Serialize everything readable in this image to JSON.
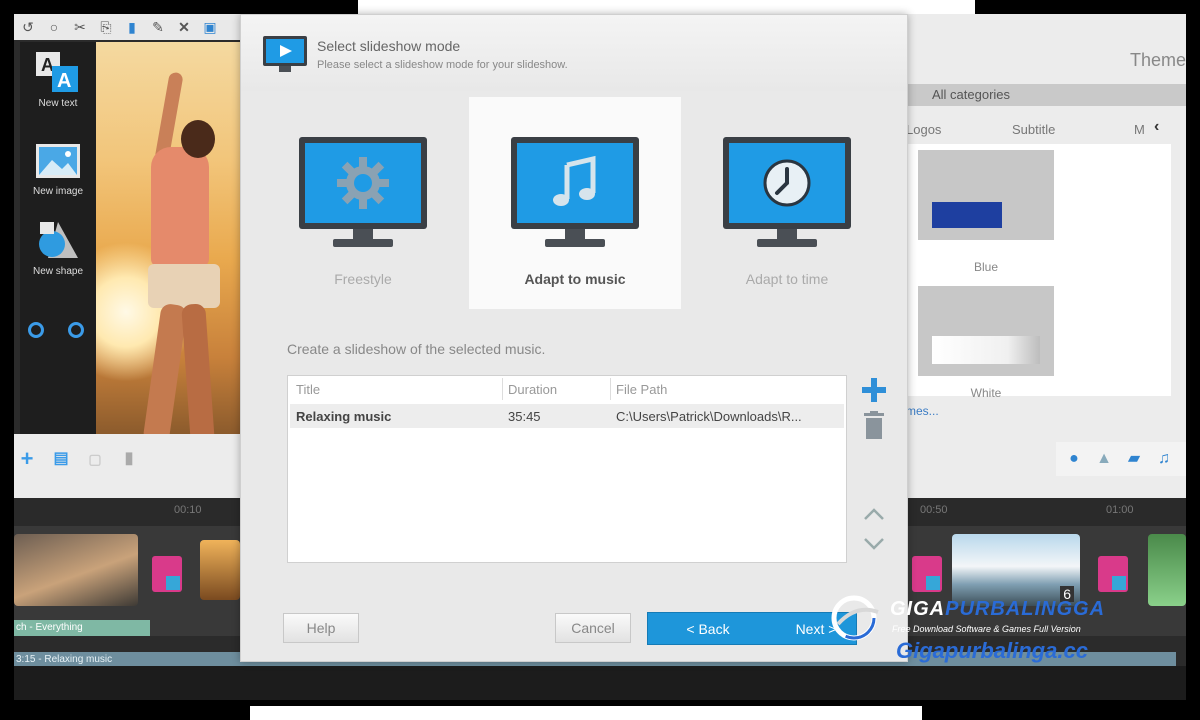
{
  "dialog": {
    "title": "Select slideshow mode",
    "subtitle": "Please select a slideshow mode for your slideshow.",
    "modes": [
      {
        "label": "Freestyle",
        "icon": "gear-icon",
        "selected": false
      },
      {
        "label": "Adapt to music",
        "icon": "music-note-icon",
        "selected": true
      },
      {
        "label": "Adapt to time",
        "icon": "clock-icon",
        "selected": false
      }
    ],
    "create_label": "Create a slideshow of the selected music.",
    "table": {
      "columns": [
        "Title",
        "Duration",
        "File Path"
      ],
      "rows": [
        {
          "title": "Relaxing music",
          "duration": "35:45",
          "path": "C:\\Users\\Patrick\\Downloads\\R..."
        }
      ]
    },
    "buttons": {
      "help": "Help",
      "cancel": "Cancel",
      "back": "< Back",
      "next": "Next >"
    }
  },
  "left_tools": [
    {
      "label": "New text",
      "icon": "text-tool-icon"
    },
    {
      "label": "New image",
      "icon": "image-tool-icon"
    },
    {
      "label": "New shape",
      "icon": "shape-tool-icon"
    }
  ],
  "timeline": {
    "ruler_left": "00:10",
    "ruler_right_a": "00:50",
    "ruler_right_b": "01:00",
    "music_1": "ch - Everything",
    "music_2": "3:15 - Relaxing music",
    "thumb_badge": "6"
  },
  "right_panel": {
    "header": "Theme",
    "category": "All categories",
    "subtabs": [
      "Logos",
      "Subtitle",
      "M"
    ],
    "themes": [
      {
        "name": "Blue"
      },
      {
        "name": "White"
      }
    ],
    "more_link": "mes..."
  },
  "watermark": {
    "brand_giga": "GIGA",
    "brand_name": "PURBALINGGA",
    "tagline": "Free Download Software & Games Full Version",
    "url": "Gigapurbalinga.cc"
  },
  "colors": {
    "accent": "#1e96da",
    "screen_blue": "#1f9be5",
    "selected_bg": "#fafafa"
  }
}
